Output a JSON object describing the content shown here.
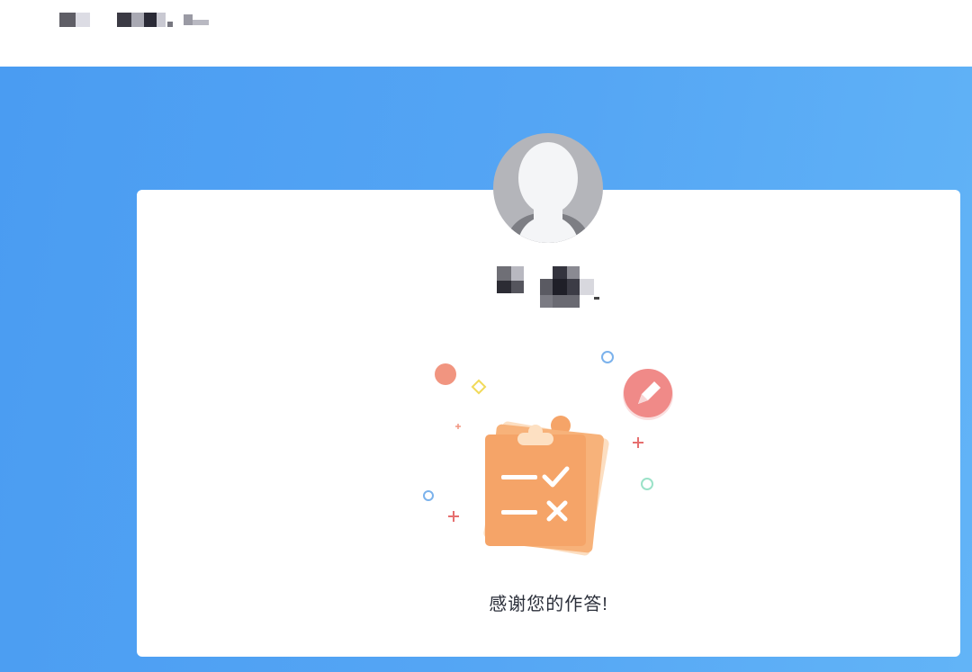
{
  "header": {
    "title_obscured": true
  },
  "user": {
    "name_obscured": true,
    "avatar": "default-avatar-icon"
  },
  "illustration": {
    "icon": "clipboard-checklist-icon",
    "badge_icon": "pencil-icon"
  },
  "message": {
    "text": "感谢您的作答!"
  },
  "colors": {
    "background_blue": "#4a9cf2",
    "card": "#ffffff",
    "clipboard_orange": "#f5a468",
    "badge_pink": "#f07f7f",
    "text_dark": "#2b2f3a"
  }
}
